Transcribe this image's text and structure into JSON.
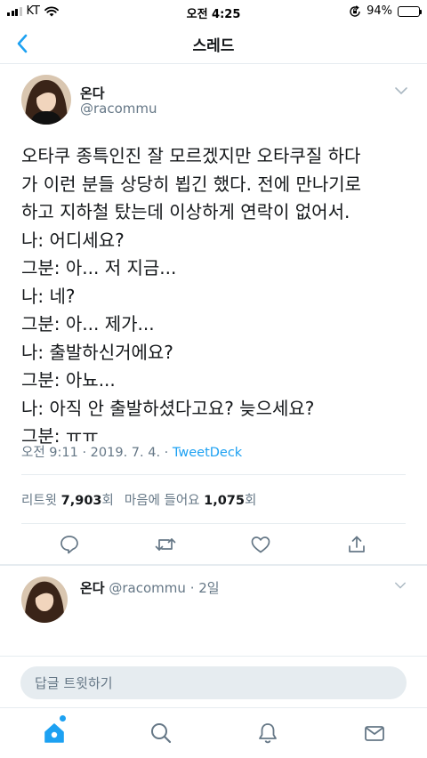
{
  "status_bar": {
    "carrier": "KT",
    "time": "오전 4:25",
    "battery": "94%",
    "battery_level": 0.94
  },
  "nav": {
    "title": "스레드"
  },
  "tweet": {
    "display_name": "온다",
    "handle": "@racommu",
    "lines": [
      "오타쿠 종특인진 잘 모르겠지만 오타쿠질 하다",
      "가 이런 분들 상당히 뵙긴 했다. 전에 만나기로",
      "하고 지하철 탔는데 이상하게 연락이 없어서.",
      "나: 어디세요?",
      "그분: 아... 저 지금...",
      "나: 네?",
      "그분: 아... 제가...",
      "나: 출발하신거에요?",
      "그분: 아뇨...",
      "나: 아직 안 출발하셨다고요? 늦으세요?",
      "그분: ㅠㅠ"
    ],
    "timestamp": "오전 9:11 · 2019. 7. 4. · ",
    "source": "TweetDeck",
    "retweets_label": "리트윗",
    "retweets_count": "7,903",
    "retweets_unit": "회",
    "likes_label": "마음에 들어요",
    "likes_count": "1,075",
    "likes_unit": "회"
  },
  "reply_preview": {
    "display_name": "온다",
    "handle": "@racommu",
    "age": "· 2일"
  },
  "composer": {
    "placeholder": "답글 트윗하기"
  },
  "icons": {
    "back": "chevron-left-icon",
    "caret": "chevron-down-icon",
    "reply": "comment-icon",
    "retweet": "retweet-icon",
    "like": "heart-icon",
    "share": "share-icon",
    "home": "home-icon",
    "search": "search-icon",
    "notifications": "bell-icon",
    "messages": "mail-icon"
  },
  "colors": {
    "accent": "#1da1f2",
    "secondary_text": "#657786",
    "primary_text": "#14171a",
    "divider": "#e6ecf0"
  }
}
